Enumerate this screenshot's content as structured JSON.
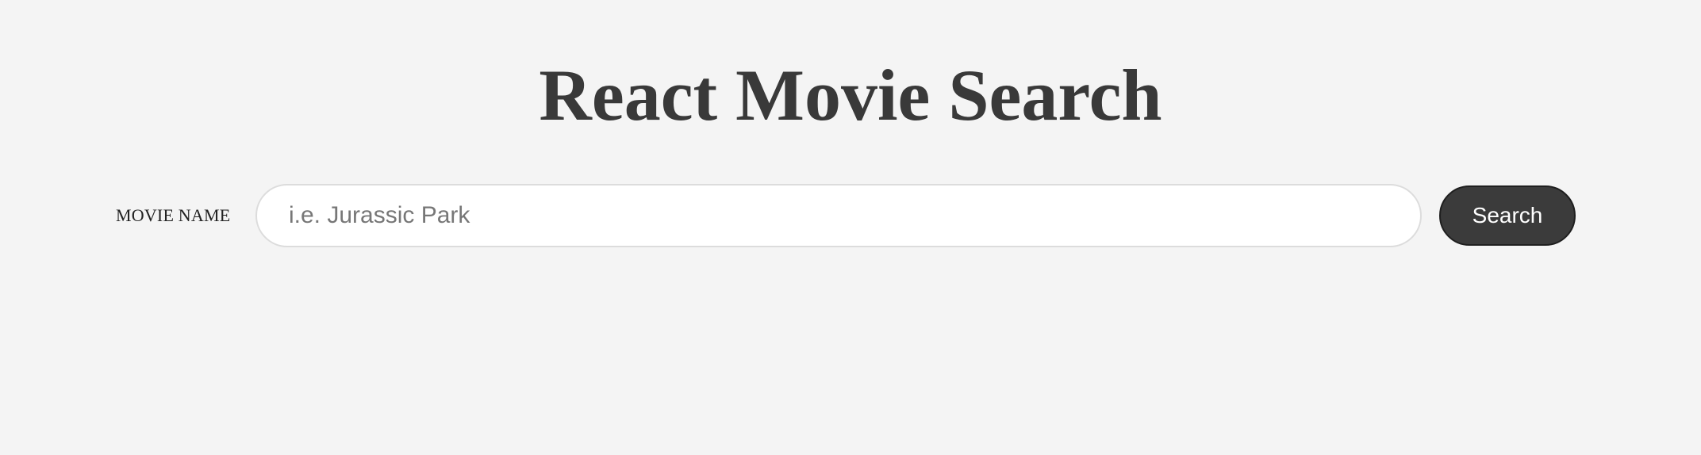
{
  "page": {
    "title": "React Movie Search"
  },
  "search": {
    "label": "MOVIE NAME",
    "placeholder": "i.e. Jurassic Park",
    "value": "",
    "button_label": "Search"
  },
  "colors": {
    "background": "#f4f4f4",
    "title": "#393939",
    "button_background": "#3b3b3b",
    "button_text": "#ffffff",
    "input_border": "#dcdcdc"
  }
}
